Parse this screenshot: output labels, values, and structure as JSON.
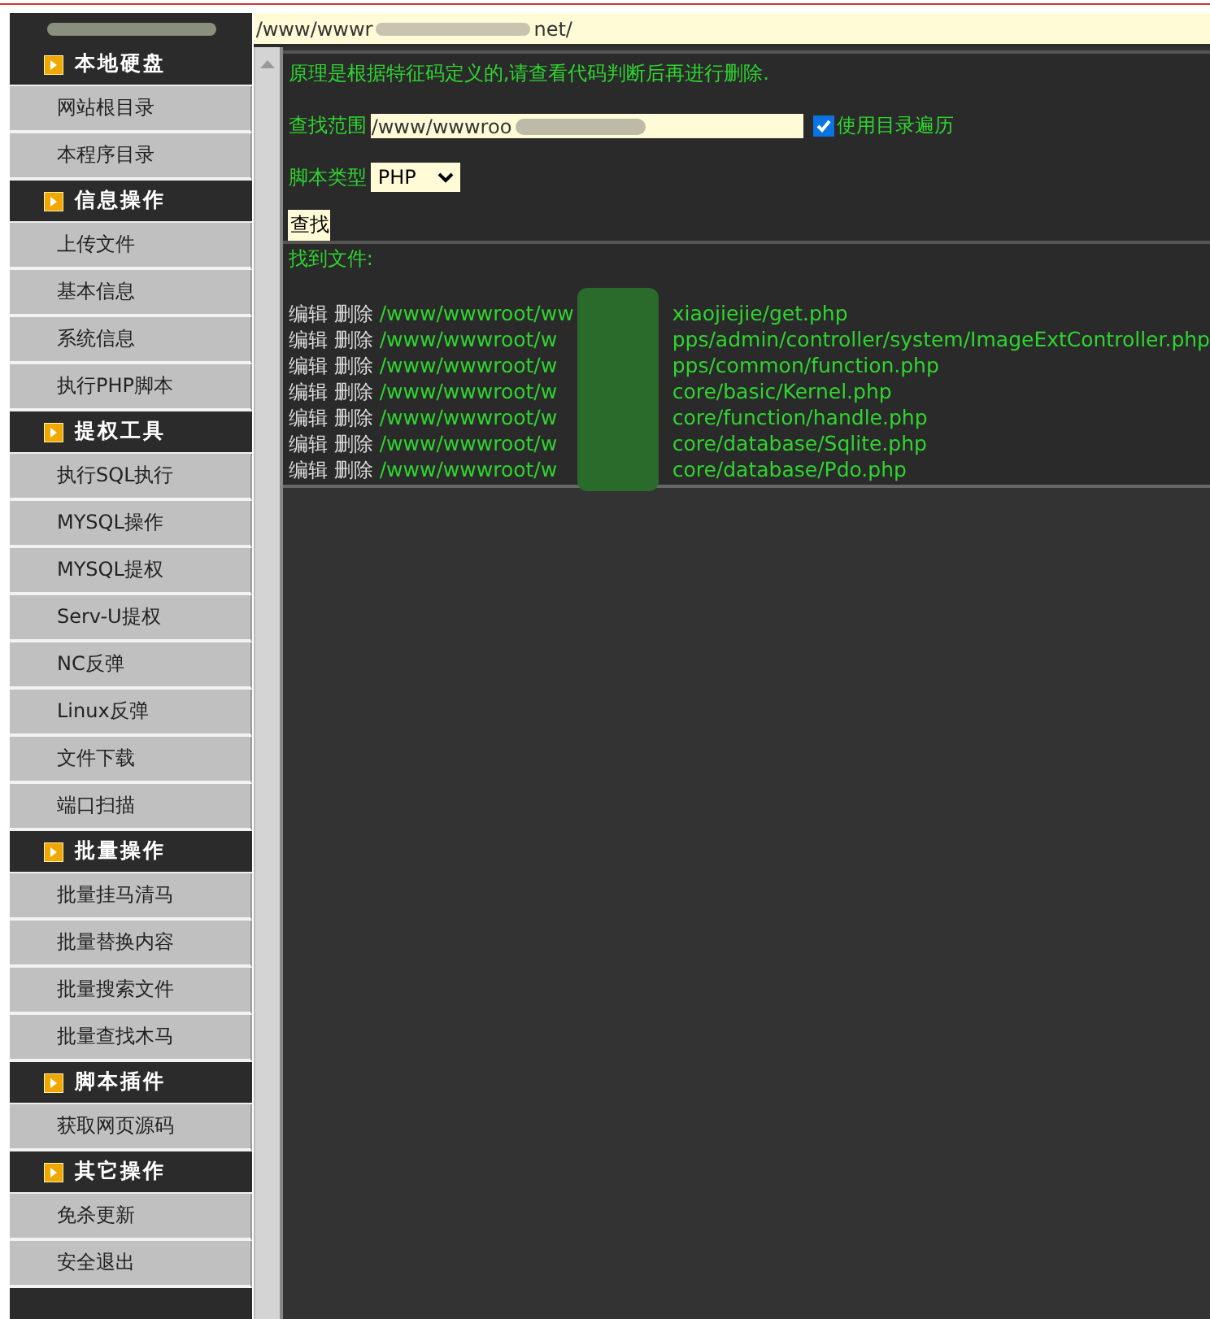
{
  "address_bar": {
    "value": "/www/wwwr",
    "value_tail": "net/"
  },
  "sidebar": {
    "sections": [
      {
        "title": "本地硬盘",
        "items": [
          "网站根目录",
          "本程序目录"
        ]
      },
      {
        "title": "信息操作",
        "items": [
          "上传文件",
          "基本信息",
          "系统信息",
          "执行PHP脚本"
        ]
      },
      {
        "title": "提权工具",
        "items": [
          "执行SQL执行",
          "MYSQL操作",
          "MYSQL提权",
          "Serv-U提权",
          "NC反弹",
          "Linux反弹",
          "文件下载",
          "端口扫描"
        ]
      },
      {
        "title": "批量操作",
        "items": [
          "批量挂马清马",
          "批量替换内容",
          "批量搜索文件",
          "批量查找木马"
        ]
      },
      {
        "title": "脚本插件",
        "items": [
          "获取网页源码"
        ]
      },
      {
        "title": "其它操作",
        "items": [
          "免杀更新",
          "安全退出"
        ]
      }
    ]
  },
  "main": {
    "notice": "原理是根据特征码定义的,请查看代码判断后再进行删除.",
    "search_range": {
      "label": "查找范围",
      "value": "/www/wwwroo"
    },
    "recurse_checkbox": {
      "label": "使用目录遍历",
      "checked": true
    },
    "script_type": {
      "label": "脚本类型",
      "value": "PHP"
    },
    "search_button": "查找",
    "results_label": "找到文件:",
    "results": [
      {
        "edit": "编辑",
        "delete": "删除",
        "path_start": "/www/wwwroot/ww",
        "path_end": "xiaojiejie/get.php"
      },
      {
        "edit": "编辑",
        "delete": "删除",
        "path_start": "/www/wwwroot/w",
        "path_end": "pps/admin/controller/system/ImageExtController.php"
      },
      {
        "edit": "编辑",
        "delete": "删除",
        "path_start": "/www/wwwroot/w",
        "path_end": "pps/common/function.php"
      },
      {
        "edit": "编辑",
        "delete": "删除",
        "path_start": "/www/wwwroot/w",
        "path_end": "core/basic/Kernel.php"
      },
      {
        "edit": "编辑",
        "delete": "删除",
        "path_start": "/www/wwwroot/w",
        "path_end": "core/function/handle.php"
      },
      {
        "edit": "编辑",
        "delete": "删除",
        "path_start": "/www/wwwroot/w",
        "path_end": "core/database/Sqlite.php"
      },
      {
        "edit": "编辑",
        "delete": "删除",
        "path_start": "/www/wwwroot/w",
        "path_end": "core/database/Pdo.php"
      }
    ]
  }
}
